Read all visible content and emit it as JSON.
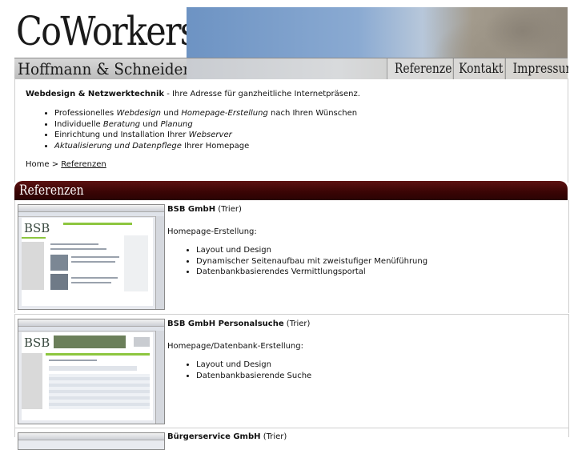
{
  "header": {
    "logo_title": "CoWorkers",
    "logo_company": "Hoffmann & Schneider GbR",
    "nav": [
      "Referenzen",
      "Kontakt",
      "Impressum"
    ]
  },
  "intro": {
    "bold": "Webdesign & Netzwerktechnik",
    "separator": " - ",
    "text": "Ihre Adresse für ganzheitliche Internetpräsenz."
  },
  "features": [
    {
      "pre": "Professionelles ",
      "it": "Webdesign",
      "mid": " und ",
      "it2": "Homepage-Erstellung",
      "post": " nach Ihren Wünschen"
    },
    {
      "pre": "Individuelle ",
      "it": "Beratung",
      "mid": " und ",
      "it2": "Planung",
      "post": ""
    },
    {
      "pre": "Einrichtung und Installation Ihrer ",
      "it": "Webserver",
      "mid": "",
      "it2": "",
      "post": ""
    },
    {
      "pre": "",
      "it": "Aktualisierung und Datenpflege",
      "mid": "",
      "it2": "",
      "post": " Ihrer Homepage"
    }
  ],
  "breadcrumb": {
    "home": "Home",
    "sep": " > ",
    "current": "Referenzen"
  },
  "section_title": "Referenzen",
  "references": [
    {
      "name": "BSB GmbH",
      "location": " (Trier)",
      "type": "Homepage-Erstellung:",
      "items": [
        "Layout und Design",
        "Dynamischer Seitenaufbau mit zweistufiger Menüführung",
        "Datenbankbasierendes Vermittlungsportal"
      ]
    },
    {
      "name": "BSB GmbH Personalsuche",
      "location": " (Trier)",
      "type": "Homepage/Datenbank-Erstellung:",
      "items": [
        "Layout und Design",
        "Datenbankbasierende Suche"
      ]
    },
    {
      "name": "Bürgerservice GmbH",
      "location": " (Trier)",
      "type": "",
      "items": []
    }
  ],
  "thumb_text": "BSB",
  "colors": {
    "section_header": "#3b0505",
    "accent_green": "#8dc63f"
  }
}
